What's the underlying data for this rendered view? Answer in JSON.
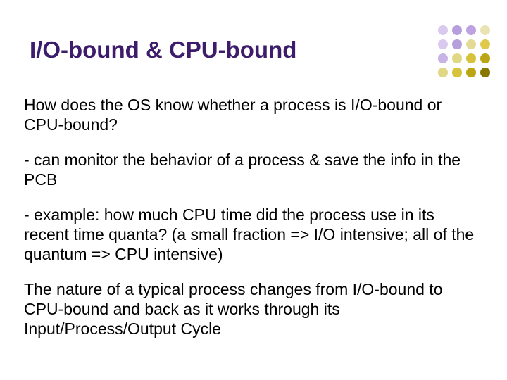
{
  "title": "I/O-bound & CPU-bound",
  "paragraphs": {
    "p1": "How does the OS know whether a process is I/O-bound or CPU-bound?",
    "p2": "- can monitor the behavior of a process & save the info in the PCB",
    "p3": "- example: how much CPU time did the process use in its recent time quanta? (a small fraction => I/O intensive; all of the quantum => CPU intensive)",
    "p4": "The nature of a typical process changes from I/O-bound to CPU-bound and back as it works through its Input/Process/Output Cycle"
  },
  "dot_colors": {
    "r0c0": "#d9c9ef",
    "r0c1": "#b79fdd",
    "r0c2": "#bda1e0",
    "r0c3": "#e9e3b4",
    "r1c0": "#d9c9ef",
    "r1c1": "#b79fdd",
    "r1c2": "#e3da96",
    "r1c3": "#dfc94a",
    "r2c0": "#c8b3e6",
    "r2c1": "#e0d885",
    "r2c2": "#d7c23c",
    "r2c3": "#bca513",
    "r3c0": "#e0d885",
    "r3c1": "#d7c23c",
    "r3c2": "#bca513",
    "r3c3": "#887600"
  }
}
